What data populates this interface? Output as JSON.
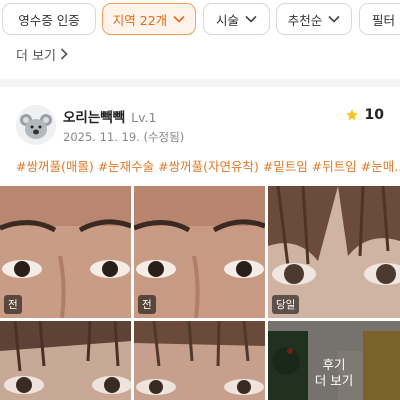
{
  "filters": {
    "chips": [
      {
        "label": "영수증 인증",
        "active": false
      },
      {
        "label": "지역 22개",
        "active": true
      },
      {
        "label": "시술",
        "active": false
      },
      {
        "label": "추천순",
        "active": false
      },
      {
        "label": "필터",
        "active": false
      }
    ],
    "more_label": "더 보기"
  },
  "review": {
    "username": "오리는빽빽",
    "level": "Lv.1",
    "date": "2025. 11. 19. (수정됨)",
    "rating": "10",
    "tags": "#쌍꺼풀(매몰) #눈재수술 #쌍꺼풀(자연유착) #밑트임 #뒤트임 #눈매...",
    "photos": [
      {
        "badge": "전"
      },
      {
        "badge": "전"
      },
      {
        "badge": "당일"
      },
      {
        "badge": ""
      },
      {
        "badge": ""
      },
      {
        "badge": "",
        "overlay_line1": "후기",
        "overlay_line2": "더 보기"
      }
    ]
  },
  "colors": {
    "accent": "#e06a1c",
    "accent_bg": "#fff3ea",
    "tag": "#e07a2a",
    "star": "#f5c518"
  },
  "icons": {
    "chevron": "chevron-down-icon",
    "more": "chevron-right-icon",
    "star": "star-icon"
  }
}
